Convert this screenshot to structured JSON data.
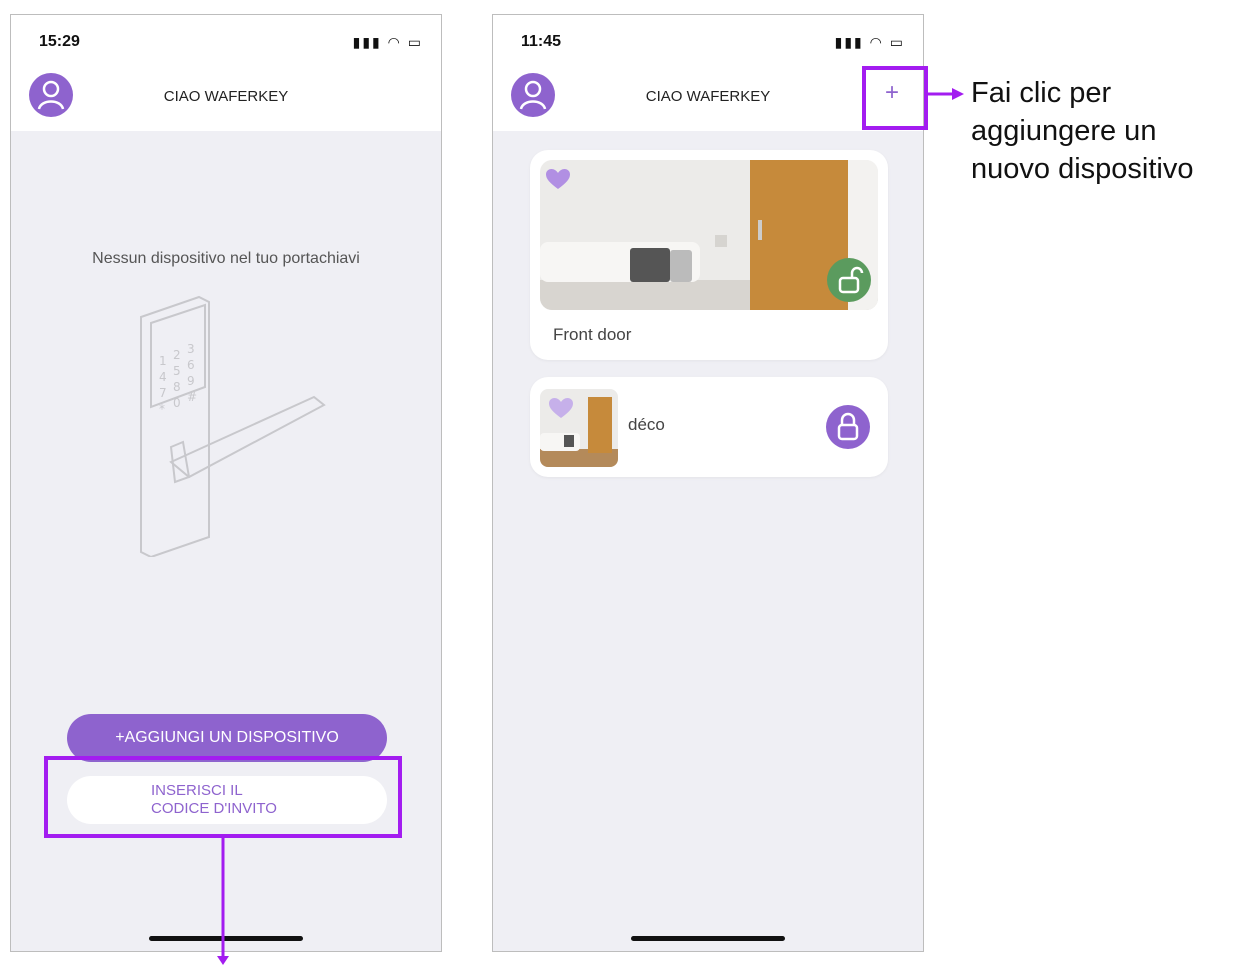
{
  "left_screen": {
    "status_time": "15:29",
    "header_title": "CIAO WAFERKEY",
    "empty_message": "Nessun dispositivo nel tuo portachiavi",
    "add_device_button": "+AGGIUNGI UN DISPOSITIVO",
    "invite_code_button": [
      "INSERISCI IL",
      "CODICE D'INVITO"
    ]
  },
  "right_screen": {
    "status_time": "11:45",
    "header_title": "CIAO WAFERKEY",
    "add_icon": "+",
    "devices": [
      {
        "name": "Front door",
        "favorite": true,
        "status": "unlocked",
        "status_color": "#5b9b5e"
      },
      {
        "name": "déco",
        "favorite": true,
        "status": "locked",
        "status_color": "#8e63ce"
      }
    ]
  },
  "annotation": {
    "note_lines": [
      "Fai clic per",
      "aggiungere un",
      "nuovo dispositivo"
    ]
  },
  "colors": {
    "accent": "#8e63ce",
    "highlight": "#a31cf0",
    "background": "#efeff4"
  },
  "icons": [
    "signal-icon",
    "wifi-icon",
    "battery-icon",
    "user-avatar-icon",
    "heart-icon",
    "unlock-icon",
    "lock-icon",
    "plus-icon",
    "arrow-icon"
  ]
}
